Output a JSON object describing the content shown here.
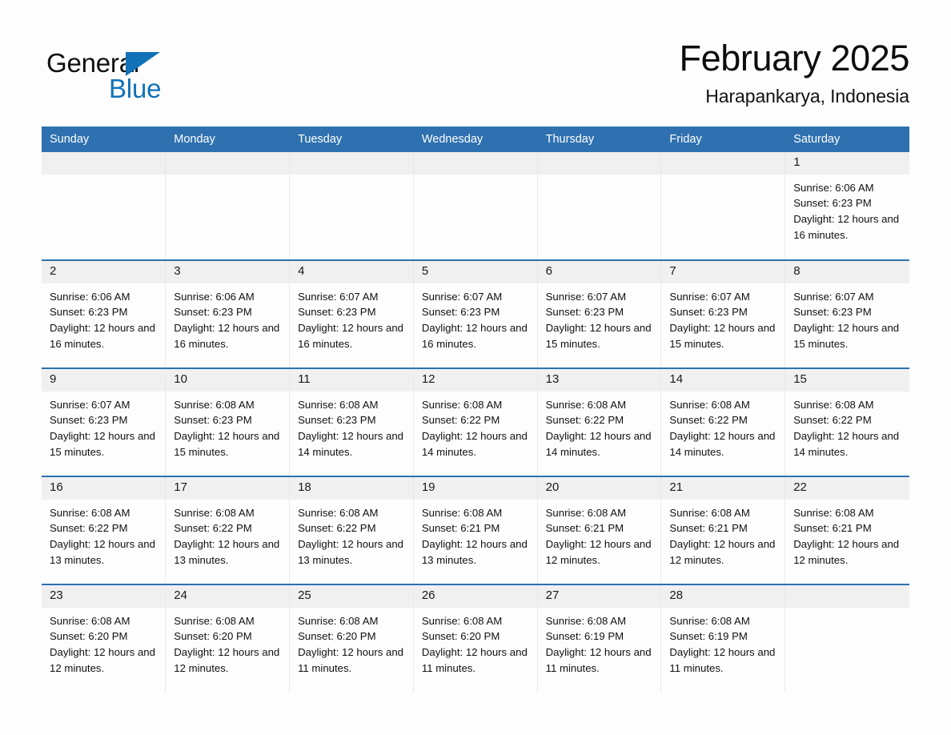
{
  "logo": {
    "word1": "General",
    "word2": "Blue",
    "triangle_color": "#1172b8",
    "icon": "general-blue-logo"
  },
  "header": {
    "title": "February 2025",
    "subtitle": "Harapankarya, Indonesia"
  },
  "colors": {
    "header_blue": "#2f71b0",
    "daynum_band": "#f0f0f0",
    "page_background": "#fdfdfd",
    "text": "#111111"
  },
  "weekday_headers": [
    "Sunday",
    "Monday",
    "Tuesday",
    "Wednesday",
    "Thursday",
    "Friday",
    "Saturday"
  ],
  "labels": {
    "sunrise_prefix": "Sunrise:",
    "sunset_prefix": "Sunset:",
    "daylight_prefix": "Daylight:"
  },
  "weeks": [
    [
      {
        "day": ""
      },
      {
        "day": ""
      },
      {
        "day": ""
      },
      {
        "day": ""
      },
      {
        "day": ""
      },
      {
        "day": ""
      },
      {
        "day": "1",
        "sunrise": "Sunrise: 6:06 AM",
        "sunset": "Sunset: 6:23 PM",
        "daylight": "Daylight: 12 hours and 16 minutes."
      }
    ],
    [
      {
        "day": "2",
        "sunrise": "Sunrise: 6:06 AM",
        "sunset": "Sunset: 6:23 PM",
        "daylight": "Daylight: 12 hours and 16 minutes."
      },
      {
        "day": "3",
        "sunrise": "Sunrise: 6:06 AM",
        "sunset": "Sunset: 6:23 PM",
        "daylight": "Daylight: 12 hours and 16 minutes."
      },
      {
        "day": "4",
        "sunrise": "Sunrise: 6:07 AM",
        "sunset": "Sunset: 6:23 PM",
        "daylight": "Daylight: 12 hours and 16 minutes."
      },
      {
        "day": "5",
        "sunrise": "Sunrise: 6:07 AM",
        "sunset": "Sunset: 6:23 PM",
        "daylight": "Daylight: 12 hours and 16 minutes."
      },
      {
        "day": "6",
        "sunrise": "Sunrise: 6:07 AM",
        "sunset": "Sunset: 6:23 PM",
        "daylight": "Daylight: 12 hours and 15 minutes."
      },
      {
        "day": "7",
        "sunrise": "Sunrise: 6:07 AM",
        "sunset": "Sunset: 6:23 PM",
        "daylight": "Daylight: 12 hours and 15 minutes."
      },
      {
        "day": "8",
        "sunrise": "Sunrise: 6:07 AM",
        "sunset": "Sunset: 6:23 PM",
        "daylight": "Daylight: 12 hours and 15 minutes."
      }
    ],
    [
      {
        "day": "9",
        "sunrise": "Sunrise: 6:07 AM",
        "sunset": "Sunset: 6:23 PM",
        "daylight": "Daylight: 12 hours and 15 minutes."
      },
      {
        "day": "10",
        "sunrise": "Sunrise: 6:08 AM",
        "sunset": "Sunset: 6:23 PM",
        "daylight": "Daylight: 12 hours and 15 minutes."
      },
      {
        "day": "11",
        "sunrise": "Sunrise: 6:08 AM",
        "sunset": "Sunset: 6:23 PM",
        "daylight": "Daylight: 12 hours and 14 minutes."
      },
      {
        "day": "12",
        "sunrise": "Sunrise: 6:08 AM",
        "sunset": "Sunset: 6:22 PM",
        "daylight": "Daylight: 12 hours and 14 minutes."
      },
      {
        "day": "13",
        "sunrise": "Sunrise: 6:08 AM",
        "sunset": "Sunset: 6:22 PM",
        "daylight": "Daylight: 12 hours and 14 minutes."
      },
      {
        "day": "14",
        "sunrise": "Sunrise: 6:08 AM",
        "sunset": "Sunset: 6:22 PM",
        "daylight": "Daylight: 12 hours and 14 minutes."
      },
      {
        "day": "15",
        "sunrise": "Sunrise: 6:08 AM",
        "sunset": "Sunset: 6:22 PM",
        "daylight": "Daylight: 12 hours and 14 minutes."
      }
    ],
    [
      {
        "day": "16",
        "sunrise": "Sunrise: 6:08 AM",
        "sunset": "Sunset: 6:22 PM",
        "daylight": "Daylight: 12 hours and 13 minutes."
      },
      {
        "day": "17",
        "sunrise": "Sunrise: 6:08 AM",
        "sunset": "Sunset: 6:22 PM",
        "daylight": "Daylight: 12 hours and 13 minutes."
      },
      {
        "day": "18",
        "sunrise": "Sunrise: 6:08 AM",
        "sunset": "Sunset: 6:22 PM",
        "daylight": "Daylight: 12 hours and 13 minutes."
      },
      {
        "day": "19",
        "sunrise": "Sunrise: 6:08 AM",
        "sunset": "Sunset: 6:21 PM",
        "daylight": "Daylight: 12 hours and 13 minutes."
      },
      {
        "day": "20",
        "sunrise": "Sunrise: 6:08 AM",
        "sunset": "Sunset: 6:21 PM",
        "daylight": "Daylight: 12 hours and 12 minutes."
      },
      {
        "day": "21",
        "sunrise": "Sunrise: 6:08 AM",
        "sunset": "Sunset: 6:21 PM",
        "daylight": "Daylight: 12 hours and 12 minutes."
      },
      {
        "day": "22",
        "sunrise": "Sunrise: 6:08 AM",
        "sunset": "Sunset: 6:21 PM",
        "daylight": "Daylight: 12 hours and 12 minutes."
      }
    ],
    [
      {
        "day": "23",
        "sunrise": "Sunrise: 6:08 AM",
        "sunset": "Sunset: 6:20 PM",
        "daylight": "Daylight: 12 hours and 12 minutes."
      },
      {
        "day": "24",
        "sunrise": "Sunrise: 6:08 AM",
        "sunset": "Sunset: 6:20 PM",
        "daylight": "Daylight: 12 hours and 12 minutes."
      },
      {
        "day": "25",
        "sunrise": "Sunrise: 6:08 AM",
        "sunset": "Sunset: 6:20 PM",
        "daylight": "Daylight: 12 hours and 11 minutes."
      },
      {
        "day": "26",
        "sunrise": "Sunrise: 6:08 AM",
        "sunset": "Sunset: 6:20 PM",
        "daylight": "Daylight: 12 hours and 11 minutes."
      },
      {
        "day": "27",
        "sunrise": "Sunrise: 6:08 AM",
        "sunset": "Sunset: 6:19 PM",
        "daylight": "Daylight: 12 hours and 11 minutes."
      },
      {
        "day": "28",
        "sunrise": "Sunrise: 6:08 AM",
        "sunset": "Sunset: 6:19 PM",
        "daylight": "Daylight: 12 hours and 11 minutes."
      },
      {
        "day": ""
      }
    ]
  ]
}
